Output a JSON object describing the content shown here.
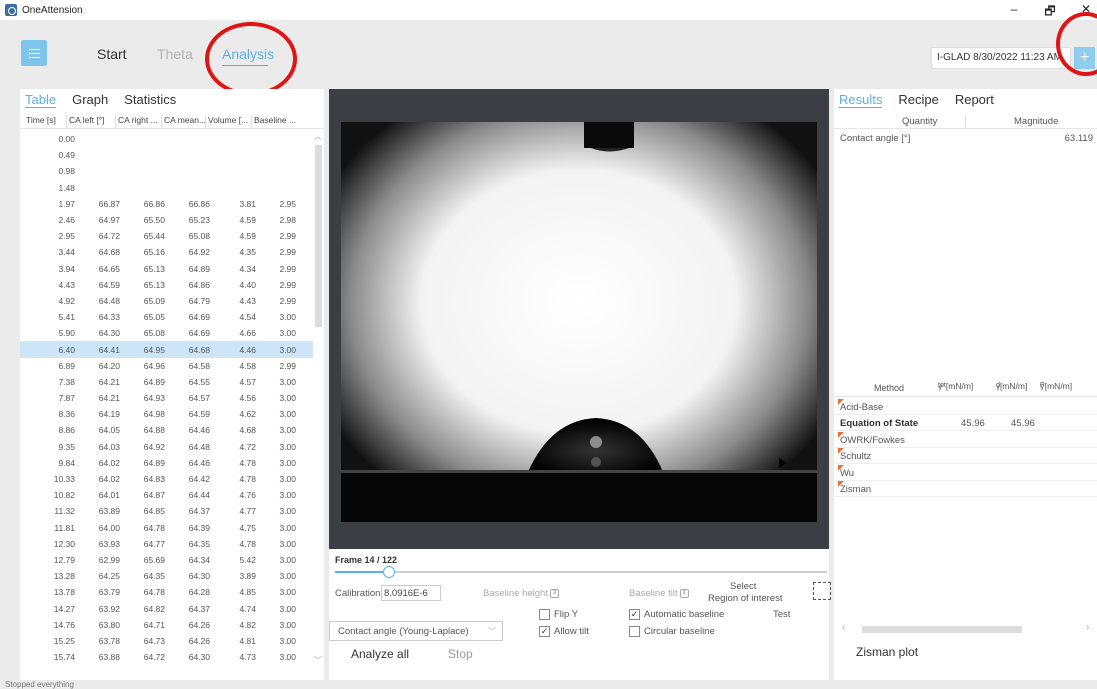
{
  "window": {
    "title": "OneAttension",
    "minimize": "–",
    "maximize": "🗗",
    "close": "✕"
  },
  "nav": {
    "start": "Start",
    "theta": "Theta",
    "analysis": "Analysis"
  },
  "session": {
    "label": "I-GLAD 8/30/2022 11:23 AM",
    "add": "+"
  },
  "left": {
    "tabs": [
      "Table",
      "Graph",
      "Statistics"
    ],
    "columns": [
      "Time [s]",
      "CA left [°]",
      "CA right ...",
      "CA mean...",
      "Volume [...",
      "Baseline ..."
    ],
    "rows": [
      [
        "0.00",
        "",
        "",
        "",
        "",
        ""
      ],
      [
        "0.49",
        "",
        "",
        "",
        "",
        ""
      ],
      [
        "0.98",
        "",
        "",
        "",
        "",
        ""
      ],
      [
        "1.48",
        "",
        "",
        "",
        "",
        ""
      ],
      [
        "1.97",
        "66.87",
        "66.86",
        "66.86",
        "3.81",
        "2.95"
      ],
      [
        "2.46",
        "64.97",
        "65.50",
        "65.23",
        "4.59",
        "2.98"
      ],
      [
        "2.95",
        "64.72",
        "65.44",
        "65.08",
        "4.59",
        "2.99"
      ],
      [
        "3.44",
        "64.68",
        "65.16",
        "64.92",
        "4.35",
        "2.99"
      ],
      [
        "3.94",
        "64.65",
        "65.13",
        "64.89",
        "4.34",
        "2.99"
      ],
      [
        "4.43",
        "64.59",
        "65.13",
        "64.86",
        "4.40",
        "2.99"
      ],
      [
        "4.92",
        "64.48",
        "65.09",
        "64.79",
        "4.43",
        "2.99"
      ],
      [
        "5.41",
        "64.33",
        "65.05",
        "64.69",
        "4.54",
        "3.00"
      ],
      [
        "5.90",
        "64.30",
        "65.08",
        "64.69",
        "4.66",
        "3.00"
      ],
      [
        "6.40",
        "64.41",
        "64.95",
        "64.68",
        "4.46",
        "3.00"
      ],
      [
        "6.89",
        "64.20",
        "64.96",
        "64.58",
        "4.58",
        "2.99"
      ],
      [
        "7.38",
        "64.21",
        "64.89",
        "64.55",
        "4.57",
        "3.00"
      ],
      [
        "7.87",
        "64.21",
        "64.93",
        "64.57",
        "4.56",
        "3.00"
      ],
      [
        "8.36",
        "64.19",
        "64.98",
        "64.59",
        "4.62",
        "3.00"
      ],
      [
        "8.86",
        "64.05",
        "64.88",
        "64.46",
        "4.68",
        "3.00"
      ],
      [
        "9.35",
        "64.03",
        "64.92",
        "64.48",
        "4.72",
        "3.00"
      ],
      [
        "9.84",
        "64.02",
        "64.89",
        "64.46",
        "4.78",
        "3.00"
      ],
      [
        "10.33",
        "64.02",
        "64.83",
        "64.42",
        "4.78",
        "3.00"
      ],
      [
        "10.82",
        "64.01",
        "64.87",
        "64.44",
        "4.76",
        "3.00"
      ],
      [
        "11.32",
        "63.89",
        "64.85",
        "64.37",
        "4.77",
        "3.00"
      ],
      [
        "11.81",
        "64.00",
        "64.78",
        "64.39",
        "4.75",
        "3.00"
      ],
      [
        "12.30",
        "63.93",
        "64.77",
        "64.35",
        "4.78",
        "3.00"
      ],
      [
        "12.79",
        "62.99",
        "65.69",
        "64.34",
        "5.42",
        "3.00"
      ],
      [
        "13.28",
        "64.25",
        "64.35",
        "64.30",
        "3.89",
        "3.00"
      ],
      [
        "13.78",
        "63.79",
        "64.78",
        "64.28",
        "4.85",
        "3.00"
      ],
      [
        "14.27",
        "63.92",
        "64.82",
        "64.37",
        "4.74",
        "3.00"
      ],
      [
        "14.76",
        "63.80",
        "64.71",
        "64.26",
        "4.82",
        "3.00"
      ],
      [
        "15.25",
        "63.78",
        "64.73",
        "64.26",
        "4.81",
        "3.00"
      ],
      [
        "15.74",
        "63.88",
        "64.72",
        "64.30",
        "4.73",
        "3.00"
      ]
    ],
    "selected_row": 13
  },
  "center": {
    "frame_label": "Frame 14 / 122",
    "frame_progress": 0.11,
    "calibration_label": "Calibration",
    "calibration_value": "8.0916E-6",
    "baseline_height": "Baseline height",
    "baseline_tilt": "Baseline tilt",
    "select": "Select",
    "region_of_interest": "Region of interest",
    "test": "Test",
    "flip_y": "Flip Y",
    "allow_tilt": "Allow tilt",
    "automatic_baseline": "Automatic baseline",
    "circular_baseline": "Circular baseline",
    "method": "Contact angle (Young-Laplace)",
    "analyze_all": "Analyze all",
    "stop": "Stop"
  },
  "right": {
    "tabs": [
      "Results",
      "Recipe",
      "Report"
    ],
    "col_quantity": "Quantity",
    "col_magnitude": "Magnitude",
    "result_name": "Contact angle [°]",
    "result_value": "63.119",
    "methods_header": {
      "method": "Method",
      "tot": "γ",
      "tot_sup": "tot",
      "d": "γ",
      "d_sup": "d",
      "p": "γ",
      "p_sup": "P",
      "unit": "[mN/m]"
    },
    "methods": [
      {
        "name": "Acid-Base",
        "tot": "",
        "d": ""
      },
      {
        "name": "Equation of State",
        "tot": "45.96",
        "d": "45.96"
      },
      {
        "name": "OWRK/Fowkes",
        "tot": "",
        "d": ""
      },
      {
        "name": "Schultz",
        "tot": "",
        "d": ""
      },
      {
        "name": "Wu",
        "tot": "",
        "d": ""
      },
      {
        "name": "Zisman",
        "tot": "",
        "d": ""
      }
    ],
    "plot_label": "Zisman plot"
  },
  "status": "Stopped everything",
  "colors": {
    "accent": "#5bb1e3",
    "annotation": "#e01414",
    "selected_row": "#cde6f7"
  }
}
